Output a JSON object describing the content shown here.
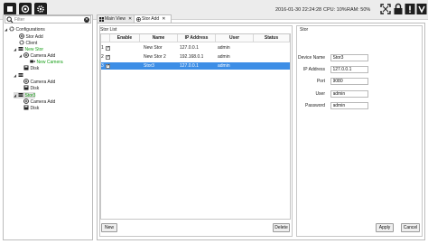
{
  "toolbar": {
    "left_icons": [
      "stop-icon",
      "camera-icon",
      "gear-icon"
    ],
    "datetime": "2016-01-30 22:24:28",
    "cpu": "CPU: 10%",
    "ram": "RAM: 50%",
    "right_icons": [
      "fullscreen-icon",
      "lock-icon",
      "alert-icon",
      "dropdown-icon"
    ]
  },
  "filter": {
    "placeholder": "Filter"
  },
  "tree": [
    {
      "label": "Configurations",
      "icon": "gear-icon",
      "expanded": true
    },
    {
      "label": "Stor Add",
      "icon": "add-circle-icon"
    },
    {
      "label": "Client",
      "icon": "gear-icon"
    },
    {
      "label": "New Stor",
      "icon": "storage-icon",
      "color": "#1aa01a",
      "expanded": true
    },
    {
      "label": "Camera Add",
      "icon": "add-circle-icon"
    },
    {
      "label": "New Camera",
      "icon": "camera-icon",
      "color": "#1aa01a"
    },
    {
      "label": "Disk",
      "icon": "disk-icon"
    },
    {
      "label": "",
      "icon": "storage-icon",
      "expanded": true
    },
    {
      "label": "Camera Add",
      "icon": "add-circle-icon"
    },
    {
      "label": "Disk",
      "icon": "disk-icon"
    },
    {
      "label": "Stor3",
      "icon": "storage-icon",
      "color": "#1aa01a",
      "expanded": true
    },
    {
      "label": "Camera Add",
      "icon": "add-circle-icon"
    },
    {
      "label": "Disk",
      "icon": "disk-icon"
    }
  ],
  "tabs": [
    {
      "label": "Main View",
      "close": "✕",
      "active": false
    },
    {
      "label": "Stor Add",
      "close": "✕",
      "active": true
    }
  ],
  "stor_list": {
    "title": "Stor List",
    "columns": [
      "",
      "Enable",
      "Name",
      "IP Address",
      "User",
      "Status"
    ],
    "rows": [
      {
        "num": "1",
        "enabled": true,
        "name": "New Stor",
        "ip": "127.0.0.1",
        "user": "admin",
        "status": "",
        "selected": false
      },
      {
        "num": "2",
        "enabled": true,
        "name": "New Stor 2",
        "ip": "192.168.0.1",
        "user": "admin",
        "status": "",
        "selected": false
      },
      {
        "num": "3",
        "enabled": true,
        "name": "Stor3",
        "ip": "127.0.0.1",
        "user": "admin",
        "status": "",
        "selected": true
      }
    ],
    "new_label": "New",
    "delete_label": "Delete"
  },
  "stor": {
    "title": "Stor",
    "fields": [
      {
        "label": "Device Name",
        "value": "Stor3"
      },
      {
        "label": "IP Address",
        "value": "127.0.0.1"
      },
      {
        "label": "Port",
        "value": "9080"
      },
      {
        "label": "User",
        "value": "admin"
      },
      {
        "label": "Password",
        "value": "admin"
      }
    ],
    "apply_label": "Apply",
    "cancel_label": "Cancel"
  },
  "colors": {
    "accent": "#3d8ee6",
    "active_node": "#1aa01a",
    "toolbar_icon": "#1e1e1e"
  }
}
